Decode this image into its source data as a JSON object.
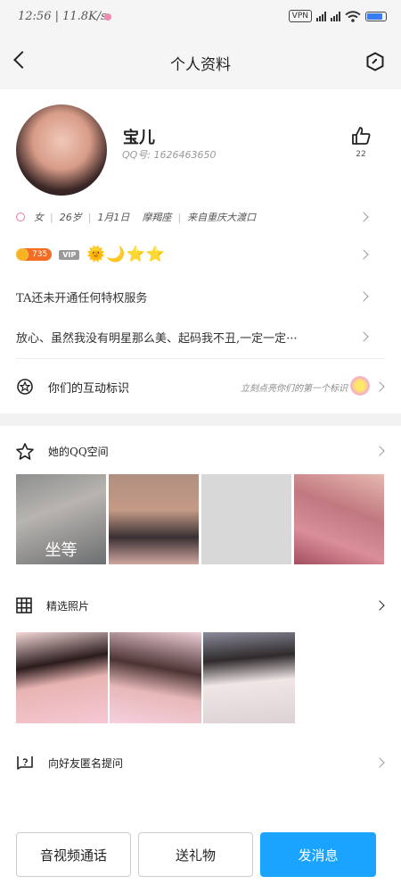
{
  "status": {
    "time": "12:56",
    "speed": "11.8K/s",
    "vpn": "VPN",
    "battery_level": 0.85
  },
  "header": {
    "title": "个人资料"
  },
  "profile": {
    "name": "宝儿",
    "qq": "QQ号: 1626463650",
    "likes": "22"
  },
  "info": {
    "gender": "女",
    "age": "26岁",
    "birthday": "1月1日",
    "zodiac": "摩羯座",
    "hometown": "来自重庆大渡口"
  },
  "badges": {
    "coins": "735",
    "vip": "VIP",
    "level_icons": "🌞🌙⭐⭐"
  },
  "privilege": "TA还未开通任何特权服务",
  "signature": "放心、虽然我没有明星那么美、起码我不丑,一定一定···",
  "interact": {
    "label": "你们的互动标识",
    "hint": "立刻点亮你们的第一个标识"
  },
  "qzone": {
    "label": "她的QQ空间",
    "photo1_caption": "坐等"
  },
  "photos": {
    "label": "精选照片"
  },
  "ask": {
    "label": "向好友匿名提问"
  },
  "buttons": {
    "call": "音视频通话",
    "gift": "送礼物",
    "message": "发消息"
  },
  "colors": {
    "accent": "#1aa3ff",
    "coin": "#f36d22"
  }
}
